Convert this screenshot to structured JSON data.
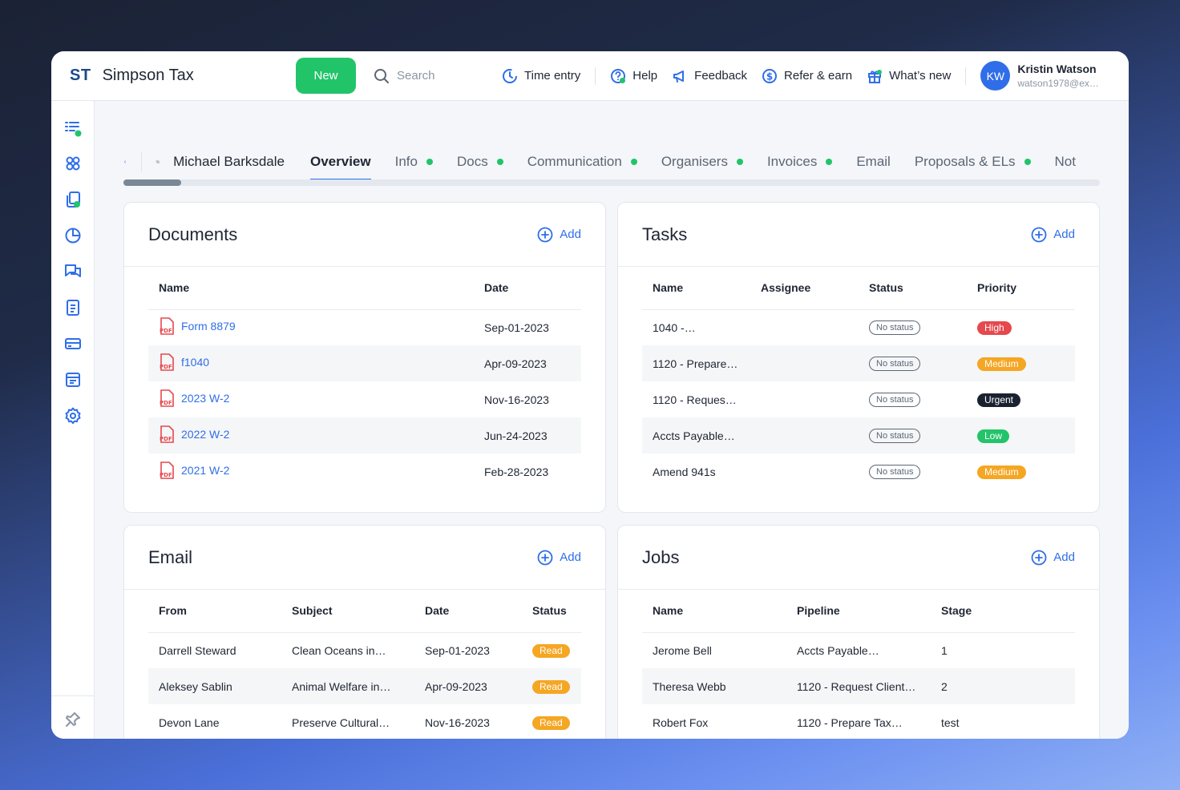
{
  "app": {
    "logo": "ST",
    "name": "Simpson Tax"
  },
  "header": {
    "new_label": "New",
    "search_placeholder": "Search",
    "links": [
      {
        "label": "Time entry",
        "icon": "clock-icon"
      },
      {
        "label": "Help",
        "icon": "help-icon"
      },
      {
        "label": "Feedback",
        "icon": "megaphone-icon"
      },
      {
        "label": "Refer & earn",
        "icon": "dollar-icon"
      },
      {
        "label": "What’s new",
        "icon": "gift-icon"
      }
    ],
    "user": {
      "initials": "KW",
      "name": "Kristin Watson",
      "email": "watson1978@ex…"
    }
  },
  "client": {
    "name": "Michael Barksdale"
  },
  "tabs": [
    {
      "label": "Overview",
      "active": true,
      "dot": false
    },
    {
      "label": "Info",
      "dot": true
    },
    {
      "label": "Docs",
      "dot": true
    },
    {
      "label": "Communication",
      "dot": true
    },
    {
      "label": "Organisers",
      "dot": true
    },
    {
      "label": "Invoices",
      "dot": true
    },
    {
      "label": "Email",
      "dot": false
    },
    {
      "label": "Proposals & ELs",
      "dot": true
    },
    {
      "label": "Not",
      "dot": false
    }
  ],
  "documents": {
    "title": "Documents",
    "add_label": "Add",
    "columns": [
      "Name",
      "Date"
    ],
    "rows": [
      {
        "name": "Form 8879",
        "date": "Sep-01-2023"
      },
      {
        "name": "f1040",
        "date": "Apr-09-2023"
      },
      {
        "name": "2023 W-2",
        "date": "Nov-16-2023"
      },
      {
        "name": "2022 W-2",
        "date": "Jun-24-2023"
      },
      {
        "name": "2021 W-2",
        "date": "Feb-28-2023"
      }
    ]
  },
  "tasks": {
    "title": "Tasks",
    "add_label": "Add",
    "columns": [
      "Name",
      "Assignee",
      "Status",
      "Priority"
    ],
    "rows": [
      {
        "name": "1040 -…",
        "status": "No status",
        "priority": "High",
        "color": "#e5484d"
      },
      {
        "name": "1120 - Prepare…",
        "status": "No status",
        "priority": "Medium",
        "color": "#f5a623"
      },
      {
        "name": "1120 - Reques…",
        "status": "No status",
        "priority": "Urgent",
        "color": "#1a2230"
      },
      {
        "name": "Accts Payable…",
        "status": "No status",
        "priority": "Low",
        "color": "#22c46a"
      },
      {
        "name": "Amend 941s",
        "status": "No status",
        "priority": "Medium",
        "color": "#f5a623"
      }
    ]
  },
  "email": {
    "title": "Email",
    "add_label": "Add",
    "columns": [
      "From",
      "Subject",
      "Date",
      "Status"
    ],
    "rows": [
      {
        "from": "Darrell Steward",
        "subject": "Clean Oceans in…",
        "date": "Sep-01-2023",
        "status": "Read"
      },
      {
        "from": "Aleksey Sablin",
        "subject": "Animal Welfare in…",
        "date": "Apr-09-2023",
        "status": "Read"
      },
      {
        "from": "Devon Lane",
        "subject": "Preserve Cultural…",
        "date": "Nov-16-2023",
        "status": "Read"
      }
    ]
  },
  "jobs": {
    "title": "Jobs",
    "add_label": "Add",
    "columns": [
      "Name",
      "Pipeline",
      "Stage"
    ],
    "rows": [
      {
        "name": "Jerome Bell",
        "pipeline": "Accts Payable…",
        "stage": "1"
      },
      {
        "name": "Theresa Webb",
        "pipeline": "1120 - Request Client…",
        "stage": "2"
      },
      {
        "name": "Robert Fox",
        "pipeline": "1120 - Prepare Tax…",
        "stage": "test"
      }
    ]
  }
}
